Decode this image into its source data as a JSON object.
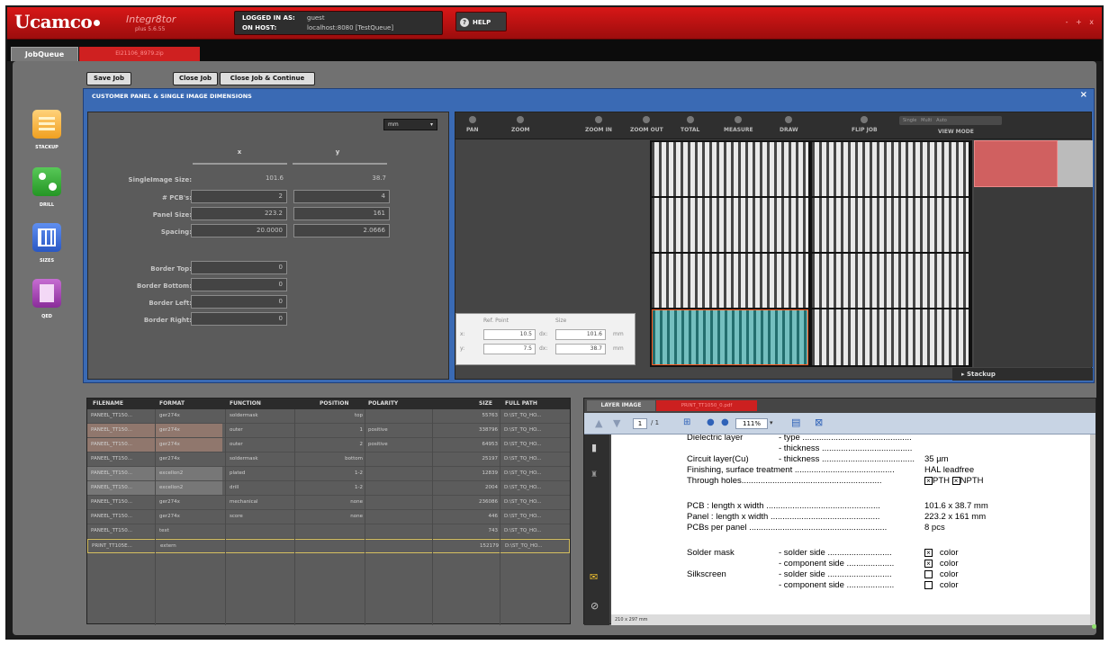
{
  "app": {
    "logo": "Ucamco",
    "logo_sub": "",
    "product": "Integr8tor",
    "version": "plus 5.6.55"
  },
  "login": {
    "logged_label": "LOGGED IN AS:",
    "user": "guest",
    "host_label": "ON HOST:",
    "host": "localhost:8080 [TestQueue]"
  },
  "help_label": "HELP",
  "window_controls": "- + x",
  "tabs": {
    "main": "JobQueue",
    "file": "EI21106_8979.zip"
  },
  "actions": {
    "save": "Save Job",
    "close": "Close Job",
    "close_continue": "Close Job & Continue"
  },
  "nav": [
    {
      "label": "STACKUP"
    },
    {
      "label": "DRILL"
    },
    {
      "label": "SIZES"
    },
    {
      "label": "QED"
    }
  ],
  "panel": {
    "title": "CUSTOMER PANEL & SINGLE IMAGE DIMENSIONS",
    "close": "×"
  },
  "dims": {
    "unit": "mm",
    "col_x": "x",
    "col_y": "y",
    "rows": [
      {
        "label": "SingleImage Size:",
        "x": "101.6",
        "y": "38.7"
      },
      {
        "label": "# PCB's:",
        "x": "2",
        "y": "4"
      },
      {
        "label": "Panel Size:",
        "x": "223.2",
        "y": "161"
      },
      {
        "label": "Spacing:",
        "x": "20.0000",
        "y": "2.0666"
      }
    ],
    "borders": [
      {
        "label": "Border Top:",
        "value": "0"
      },
      {
        "label": "Border Bottom:",
        "value": "0"
      },
      {
        "label": "Border Left:",
        "value": "0"
      },
      {
        "label": "Border Right:",
        "value": "0"
      }
    ]
  },
  "viewer": {
    "tools": [
      "PAN",
      "ZOOM",
      "ZOOM IN",
      "ZOOM OUT",
      "TOTAL",
      "MEASURE",
      "DRAW",
      "FLIP JOB",
      "VIEW MODE"
    ],
    "view_modes": [
      "Single",
      "Multi",
      "Auto"
    ],
    "ref": {
      "ref_label": "Ref. Point",
      "size_label": "Size",
      "x_label": "x:",
      "y_label": "y:",
      "dx_label": "dx:",
      "dy_label": "dy:",
      "x": "10.5",
      "y": "7.5",
      "dx": "101.6",
      "dy": "38.7",
      "unit": "mm"
    },
    "stackup_label": "Stackup"
  },
  "files": {
    "headers": [
      "FILENAME",
      "FORMAT",
      "FUNCTION",
      "POSITION",
      "POLARITY",
      "SIZE",
      "FULL PATH"
    ],
    "rows": [
      {
        "name": "PANEEL_TT150...",
        "format": "ger274x",
        "function": "soldermask",
        "position": "top",
        "polarity": "",
        "size": "55763",
        "path": "D:\\ST_TQ_HO..."
      },
      {
        "name": "PANEEL_TT150...",
        "format": "ger274x",
        "function": "outer",
        "position": "1",
        "polarity": "positive",
        "size": "338796",
        "path": "D:\\ST_TQ_HO..."
      },
      {
        "name": "PANEEL_TT150...",
        "format": "ger274x",
        "function": "outer",
        "position": "2",
        "polarity": "positive",
        "size": "64953",
        "path": "D:\\ST_TQ_HO..."
      },
      {
        "name": "PANEEL_TT150...",
        "format": "ger274x",
        "function": "soldermask",
        "position": "bottom",
        "polarity": "",
        "size": "25197",
        "path": "D:\\ST_TQ_HO..."
      },
      {
        "name": "PANEEL_TT150...",
        "format": "excellon2",
        "function": "plated",
        "position": "1-2",
        "polarity": "",
        "size": "12839",
        "path": "D:\\ST_TQ_HO..."
      },
      {
        "name": "PANEEL_TT150...",
        "format": "excellon2",
        "function": "drill",
        "position": "1-2",
        "polarity": "",
        "size": "2004",
        "path": "D:\\ST_TQ_HO..."
      },
      {
        "name": "PANEEL_TT150...",
        "format": "ger274x",
        "function": "mechanical",
        "position": "none",
        "polarity": "",
        "size": "236086",
        "path": "D:\\ST_TQ_HO..."
      },
      {
        "name": "PANEEL_TT150...",
        "format": "ger274x",
        "function": "score",
        "position": "none",
        "polarity": "",
        "size": "446",
        "path": "D:\\ST_TQ_HO..."
      },
      {
        "name": "PANEEL_TT150...",
        "format": "text",
        "function": "",
        "position": "",
        "polarity": "",
        "size": "743",
        "path": "D:\\ST_TQ_HO..."
      },
      {
        "name": "PRINT_TT105E...",
        "format": "extern",
        "function": "",
        "position": "",
        "polarity": "",
        "size": "152179",
        "path": "D:\\ST_TQ_HO..."
      }
    ]
  },
  "layer": {
    "tab1": "LAYER IMAGE",
    "tab2": "PRINT_TT1050_0.pdf",
    "page": "1",
    "pages": "/ 1",
    "zoom": "111%",
    "status": "210 x 297 mm",
    "doc": {
      "l1": "Dielectric layer",
      "l1b": "- type ..............................................",
      "l2b": "- thickness ......................................",
      "l3": "Circuit layer(Cu)",
      "l3b": "- thickness .......................................",
      "l3v": "35 µm",
      "l4": "Finishing, surface treatment ..........................................",
      "l4v": "HAL leadfree",
      "l5": "Through holes...........................................................",
      "l5a": "PTH",
      "l5b": "NPTH",
      "l6": "PCB : length x width ................................................",
      "l6v": "101.6 x 38.7 mm",
      "l7": "Panel : length x width ..............................................",
      "l7v": "223.2 x 161 mm",
      "l8": "PCBs per panel ..........................................................",
      "l8v": "8 pcs",
      "l9": "Solder mask",
      "l9b": "- solder side ...........................",
      "l9v": "color",
      "l10b": "- component side ....................",
      "l10v": "color",
      "l11": "Silkscreen",
      "l11b": "- solder side ...........................",
      "l11v": "color",
      "l12b": "- component side ....................",
      "l12v": "color"
    }
  }
}
